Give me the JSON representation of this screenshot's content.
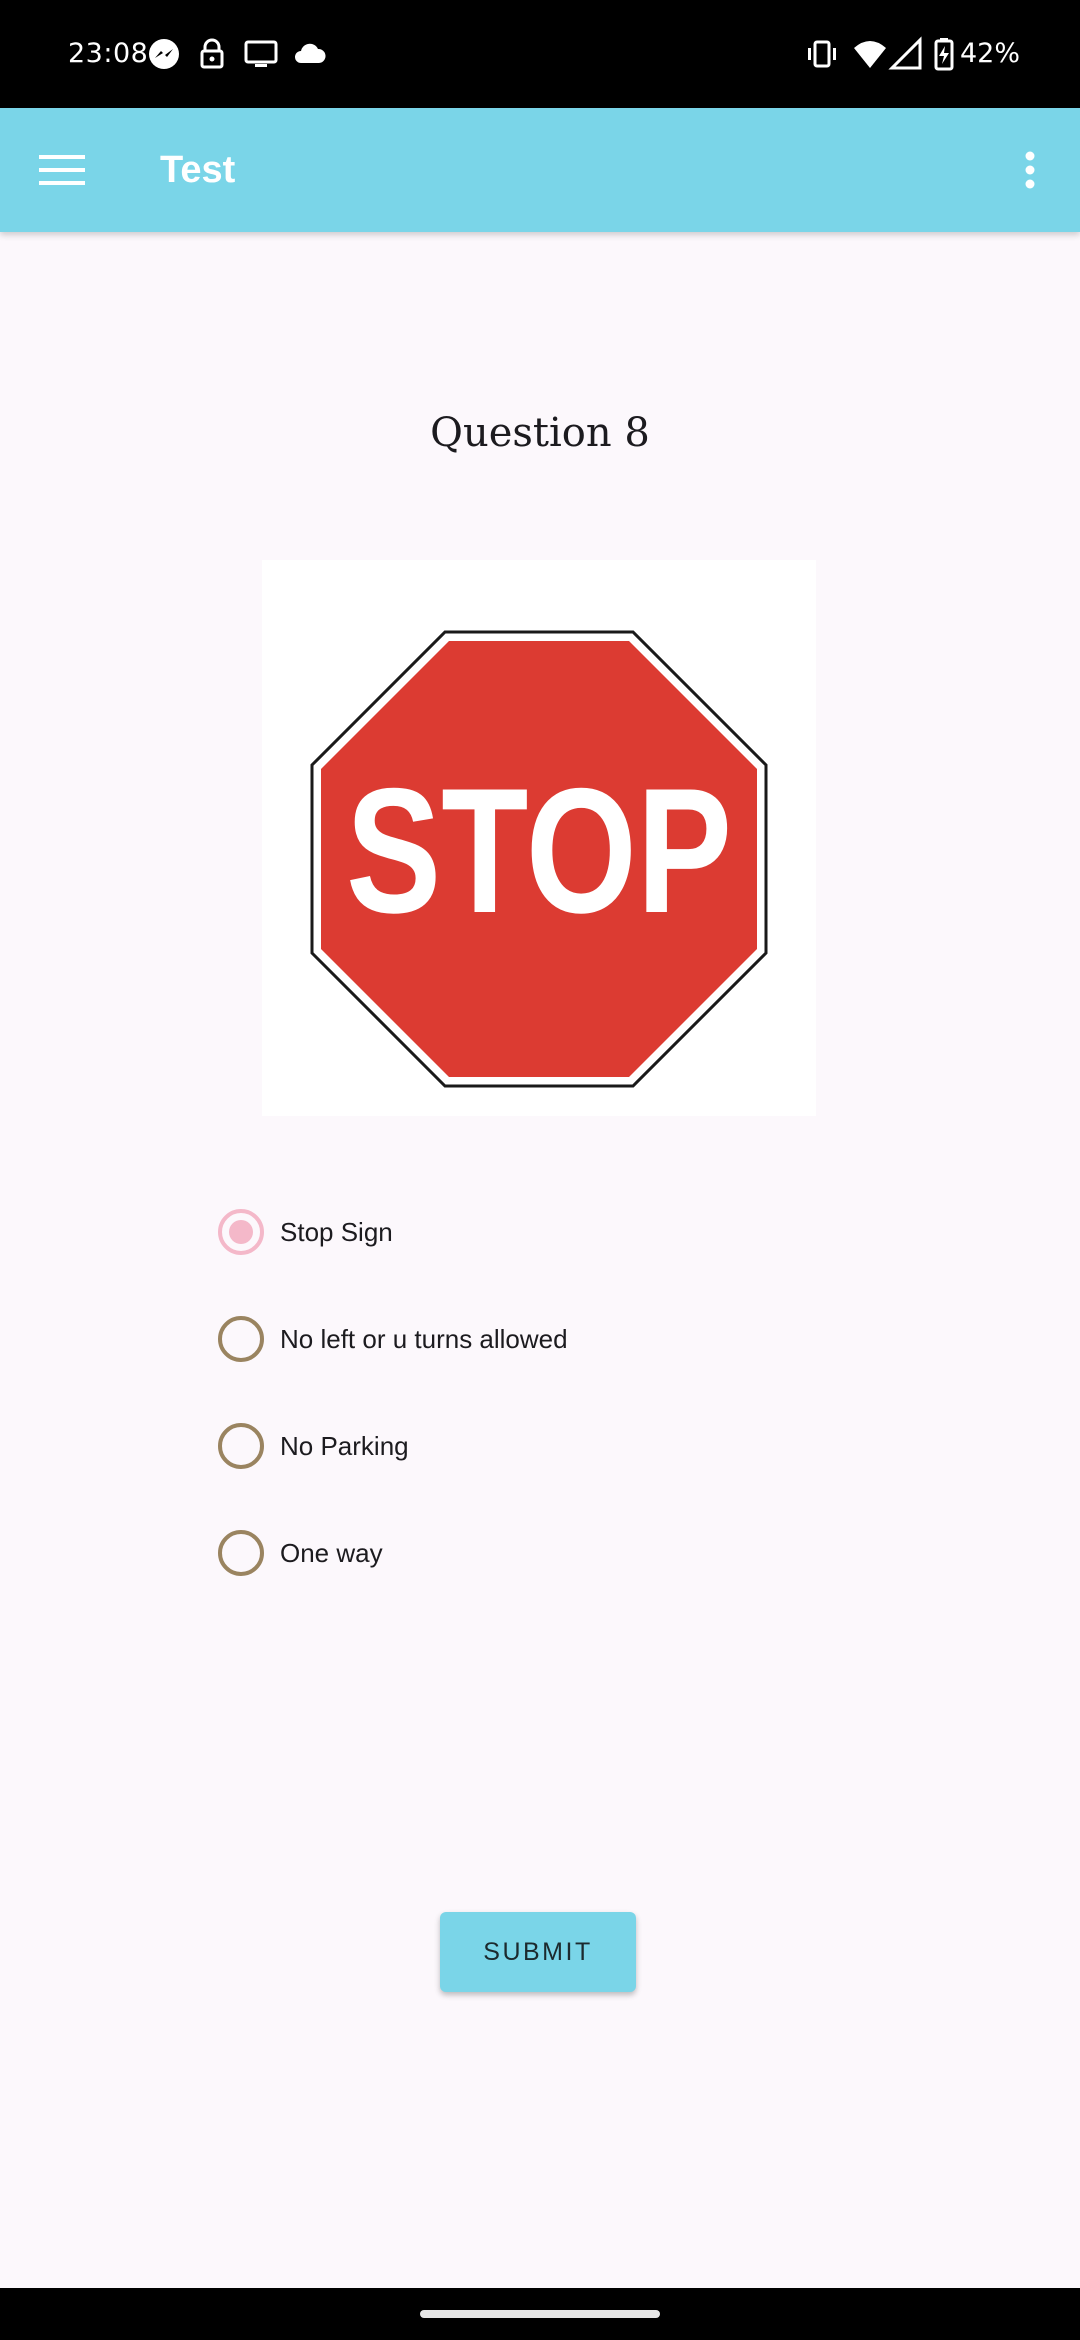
{
  "status_bar": {
    "time": "23:08",
    "battery": "42%",
    "icons": [
      "messenger-icon",
      "lock-icon",
      "cast-icon",
      "cloud-icon",
      "vibrate-icon",
      "wifi-icon",
      "signal-icon",
      "battery-charging-icon"
    ]
  },
  "app_bar": {
    "title": "Test",
    "menu_icon": "hamburger-menu-icon",
    "overflow_icon": "more-vert-icon",
    "color": "#7ad5e8"
  },
  "question": {
    "title": "Question 8",
    "image": "stop-sign",
    "sign_text": "STOP",
    "options": [
      {
        "label": "Stop Sign",
        "selected": true
      },
      {
        "label": "No left or u turns allowed",
        "selected": false
      },
      {
        "label": "No Parking",
        "selected": false
      },
      {
        "label": "One way",
        "selected": false
      }
    ]
  },
  "submit": {
    "label": "SUBMIT"
  },
  "colors": {
    "accent": "#7ad5e8",
    "radio_selected": "#f4b8c9",
    "radio_unselected": "#9a8460",
    "stop_red": "#dc3b32"
  }
}
